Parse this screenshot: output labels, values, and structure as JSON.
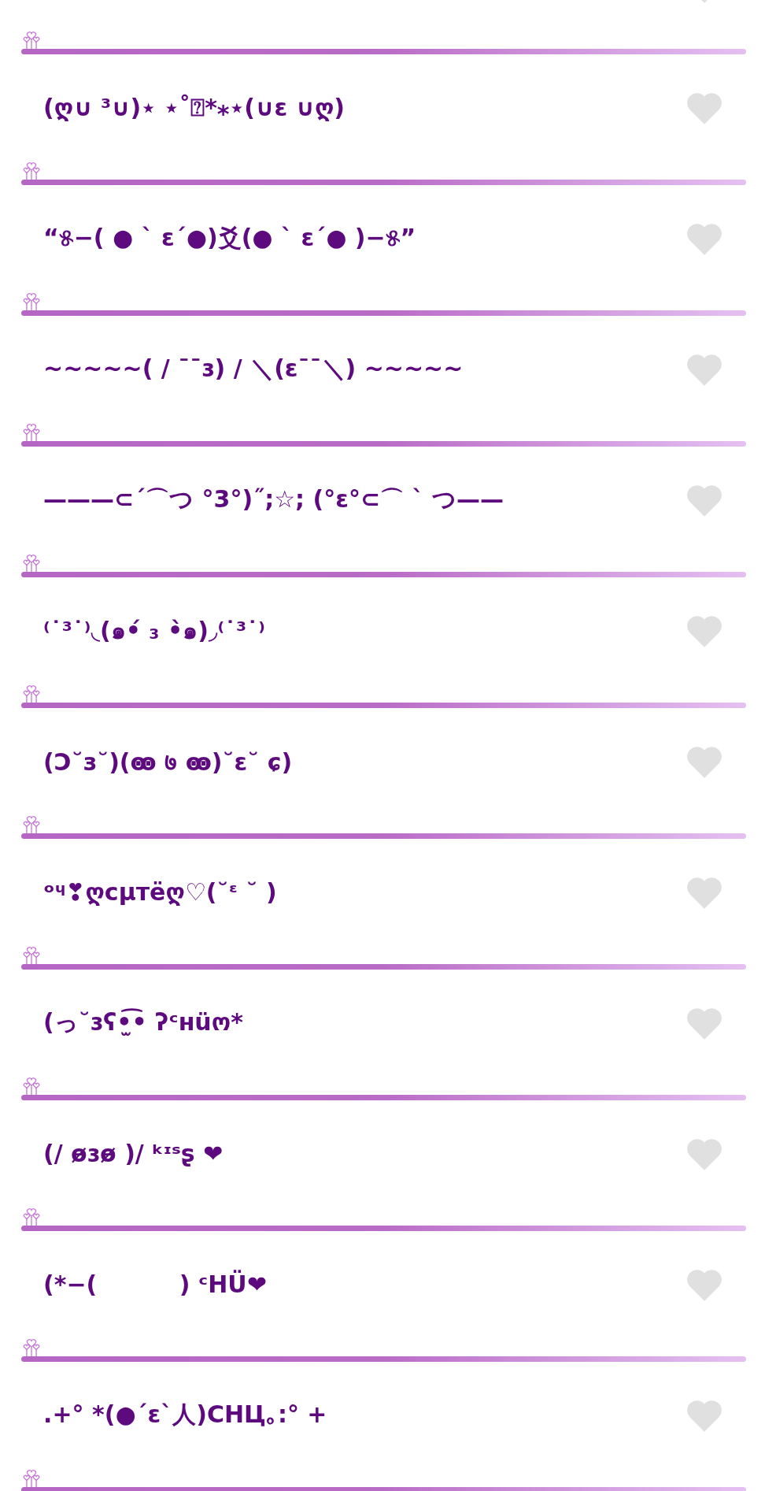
{
  "items": [
    {
      "text": "(ღ∪ ³∪)⋆ ⋆˚⍰*⁎⋆(∪ε ∪ღ)",
      "liked": false
    },
    {
      "text": "“୫−( ● ` ε´●)爻(● ` ε´● )−୫”",
      "liked": false
    },
    {
      "text": "~~~~~( / ¯¯ɜ) / ＼(ε¯¯＼) ~~~~~",
      "liked": false
    },
    {
      "text": "———⊂´⌒つ °3°)˝;☆; (°ε°⊂⌒ ` つ——",
      "liked": false
    },
    {
      "text": "⁽˙³˙⁾◟(๑•́ ₃ •̀๑)◞⁽˙³˙⁾",
      "liked": false
    },
    {
      "text": "(Ↄ˘з˘)(ꙭ ७ ꙭ)˘ε˘ ɕ)",
      "liked": false
    },
    {
      "text": "ᵒᶣ❣ღcμтёღ♡(˘ᵋ ˘ )",
      "liked": false
    },
    {
      "text": "(っ˘ɜʕ•̫͡• ʔᶜнüო*",
      "liked": false
    },
    {
      "text": "(/ ɵ̷ɜɵ̷ )/ ᵏᶦˢʂ ❤",
      "liked": false
    },
    {
      "text": "(*−(          ) ᶜHÜ❤",
      "liked": false
    },
    {
      "text": ".+° *(●´ε`人)CHЦ｡:° +",
      "liked": false
    }
  ]
}
